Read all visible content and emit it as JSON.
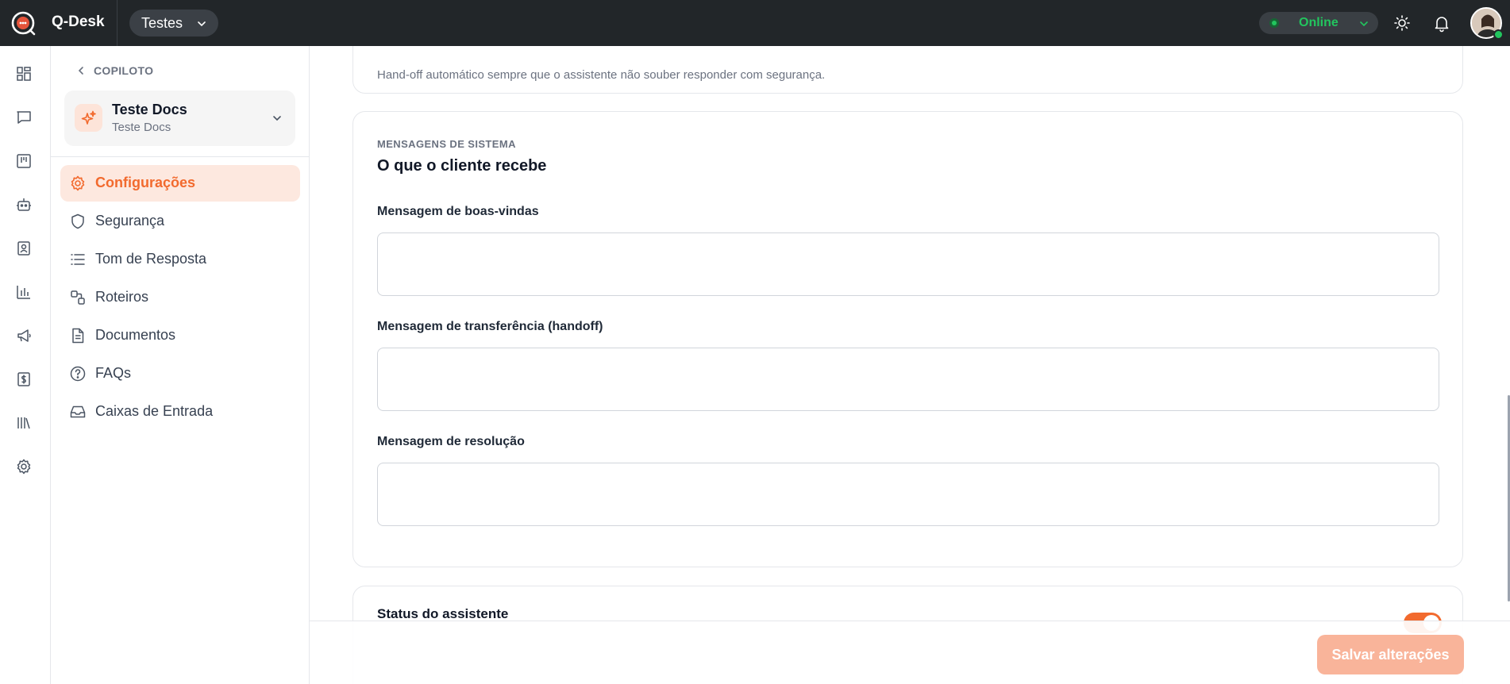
{
  "topbar": {
    "app_name": "Q-Desk",
    "workspace": "Testes",
    "status": "Online",
    "icons": [
      "logo-icon",
      "sun-icon",
      "bell-icon"
    ]
  },
  "rail": {
    "icons": [
      "dashboard-icon",
      "chat-icon",
      "kanban-icon",
      "bot-icon",
      "contacts-icon",
      "reports-icon",
      "campaigns-icon",
      "billing-icon",
      "library-icon",
      "settings-icon"
    ]
  },
  "sidebar": {
    "back_label": "COPILOTO",
    "assistant": {
      "name": "Teste Docs",
      "subtitle": "Teste Docs"
    },
    "items": [
      {
        "label": "Configurações",
        "icon": "gear-icon",
        "active": true
      },
      {
        "label": "Segurança",
        "icon": "shield-icon"
      },
      {
        "label": "Tom de Resposta",
        "icon": "list-icon"
      },
      {
        "label": "Roteiros",
        "icon": "flow-icon"
      },
      {
        "label": "Documentos",
        "icon": "document-icon"
      },
      {
        "label": "FAQs",
        "icon": "help-icon"
      },
      {
        "label": "Caixas de Entrada",
        "icon": "inbox-icon"
      }
    ]
  },
  "content": {
    "handoff_description": "Hand-off automático sempre que o assistente não souber responder com segurança.",
    "system_messages": {
      "eyebrow": "MENSAGENS DE SISTEMA",
      "title": "O que o cliente recebe",
      "fields": [
        {
          "label": "Mensagem de boas-vindas",
          "value": ""
        },
        {
          "label": "Mensagem de transferência (handoff)",
          "value": ""
        },
        {
          "label": "Mensagem de resolução",
          "value": ""
        }
      ]
    },
    "assistant_status": {
      "label": "Status do assistente",
      "enabled": true
    },
    "save_label": "Salvar alterações"
  },
  "colors": {
    "accent": "#f26a2e",
    "topbar": "#222629",
    "online": "#22c55e"
  }
}
